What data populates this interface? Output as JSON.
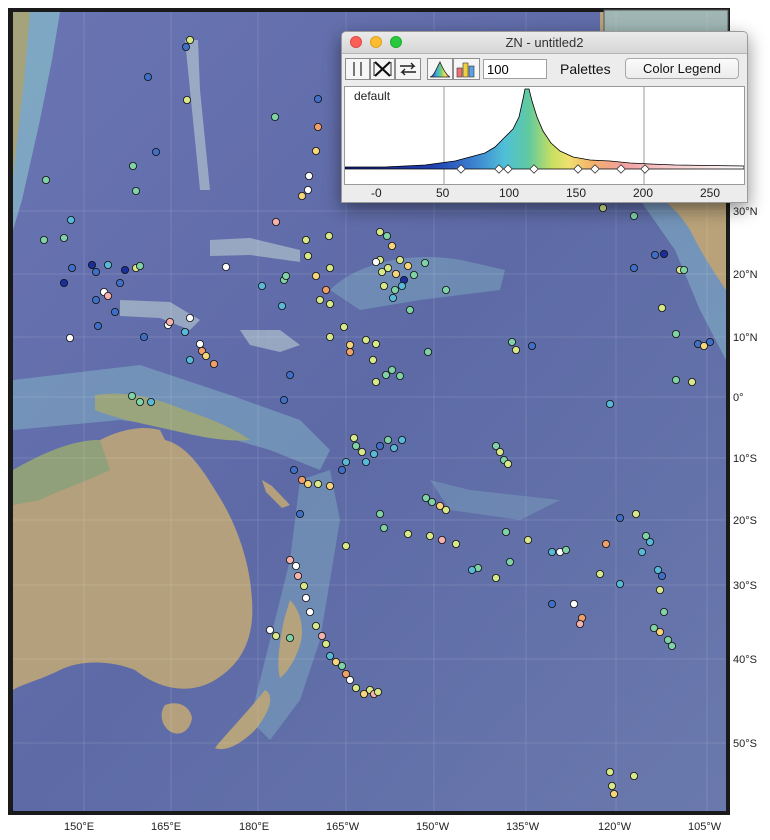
{
  "window": {
    "title": "ZN - untitled2",
    "value_input": "100",
    "palettes_label": "Palettes",
    "legend_button": "Color Legend",
    "palette_name": "default",
    "axis_ticks": [
      "-0",
      "50",
      "100",
      "150",
      "200",
      "250"
    ]
  },
  "map": {
    "lon_labels": [
      "150°E",
      "165°E",
      "180°E",
      "165°W",
      "150°W",
      "135°W",
      "120°W",
      "105°W"
    ],
    "lat_labels": [
      "30°N",
      "20°N",
      "10°N",
      "0°",
      "10°S",
      "20°S",
      "30°S",
      "40°S",
      "50°S"
    ],
    "colors": {
      "ocean_deep": "#5d6ba8",
      "ocean_shelf": "#8ec6cf",
      "land": "#b7a37f",
      "samples": [
        "#1a2f9e",
        "#3f6fc7",
        "#58b9d8",
        "#7fd3a7",
        "#d8e98a",
        "#f7d57a",
        "#f2a06a",
        "#f6b2ad",
        "#ffffff"
      ]
    }
  }
}
